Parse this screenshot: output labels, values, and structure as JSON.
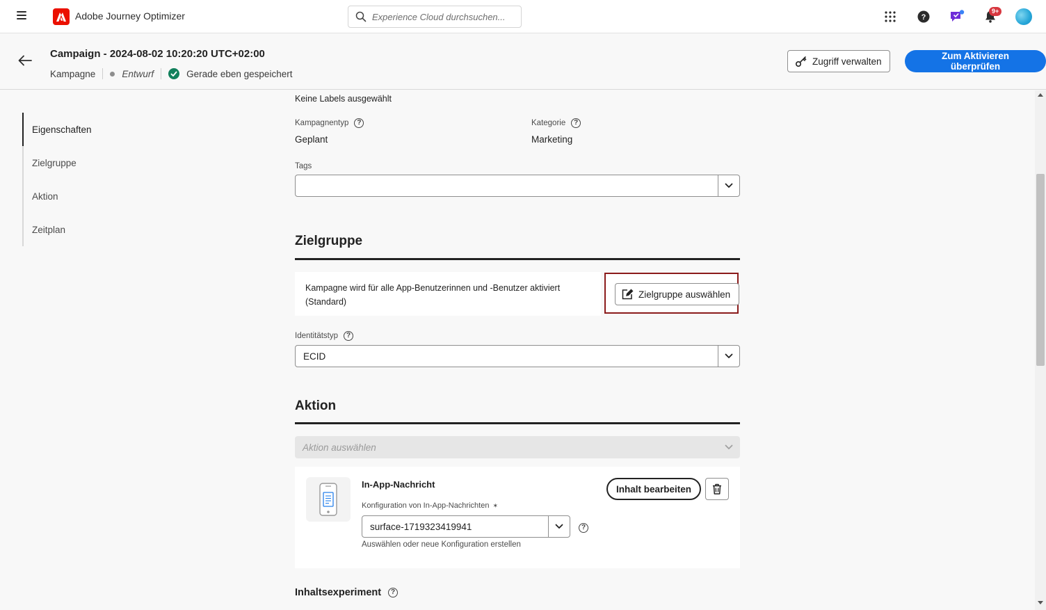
{
  "shell": {
    "app_name": "Adobe Journey Optimizer",
    "search_placeholder": "Experience Cloud durchsuchen...",
    "notifications_badge": "9+",
    "brand_color": "#eb1000"
  },
  "header": {
    "title": "Campaign - 2024-08-02 10:20:20 UTC+02:00",
    "type": "Kampagne",
    "status": "Entwurf",
    "save_status": "Gerade eben gespeichert",
    "manage_access_label": "Zugriff verwalten",
    "review_activate_label": "Zum Aktivieren überprüfen",
    "accent_color": "#1473e6"
  },
  "leftnav": {
    "items": [
      {
        "label": "Eigenschaften"
      },
      {
        "label": "Zielgruppe"
      },
      {
        "label": "Aktion"
      },
      {
        "label": "Zeitplan"
      }
    ]
  },
  "properties": {
    "labels_text": "Keine Labels ausgewählt",
    "campaign_type_label": "Kampagnentyp",
    "campaign_type_value": "Geplant",
    "category_label": "Kategorie",
    "category_value": "Marketing",
    "tags_label": "Tags",
    "tags_value": ""
  },
  "audience": {
    "title": "Zielgruppe",
    "description_line1": "Kampagne wird für alle App-Benutzerinnen und -Benutzer aktiviert",
    "description_line2": "(Standard)",
    "select_button": "Zielgruppe auswählen",
    "identity_type_label": "Identitätstyp",
    "identity_type_value": "ECID"
  },
  "action": {
    "title": "Aktion",
    "select_placeholder": "Aktion auswählen",
    "channel_name": "In-App-Nachricht",
    "edit_content_label": "Inhalt bearbeiten",
    "config_label": "Konfiguration von In-App-Nachrichten",
    "required_mark": "✶",
    "config_value": "surface-1719323419941",
    "config_help": "Auswählen oder neue Konfiguration erstellen"
  },
  "content_experiment": {
    "title": "Inhaltsexperiment"
  }
}
